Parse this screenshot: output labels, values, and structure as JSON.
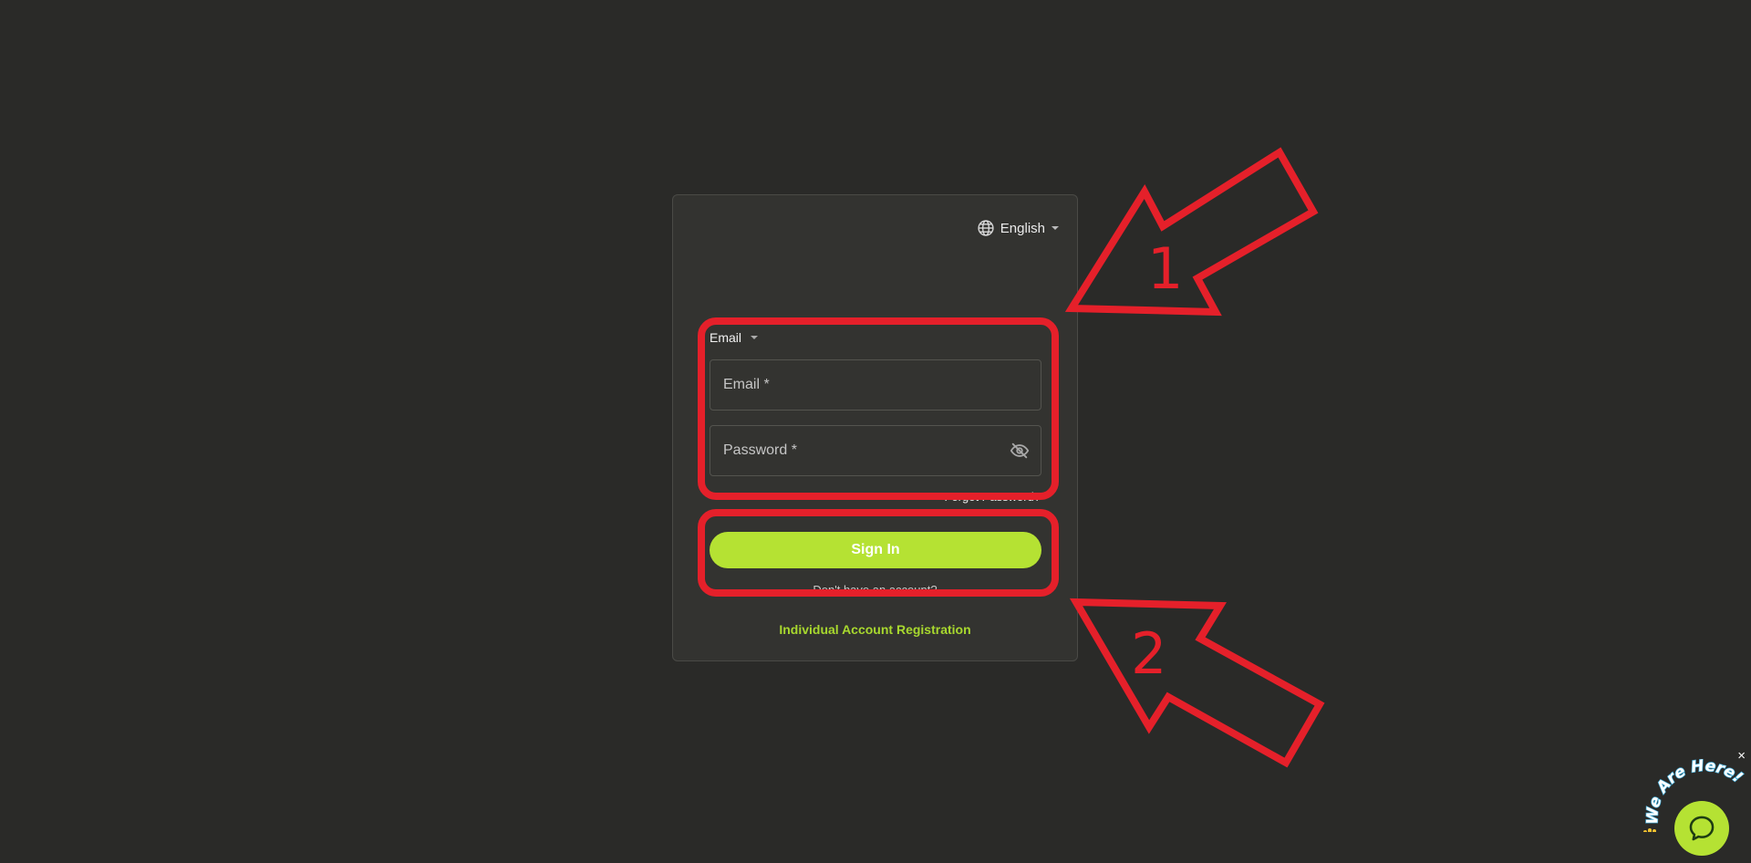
{
  "login": {
    "language": "English",
    "method_selector": "Email",
    "email_placeholder": "Email *",
    "password_placeholder": "Password *",
    "forgot_password": "Forgot Password?",
    "sign_in": "Sign In",
    "other_link": "Don't have an account?",
    "register_link": "Individual Account Registration"
  },
  "annotations": {
    "arrow1_label": "1",
    "arrow2_label": "2"
  },
  "chat_widget": {
    "tagline": "We Are Here!",
    "close_symbol": "×"
  },
  "colors": {
    "page_bg": "#2a2a28",
    "card_bg": "#333330",
    "accent": "#b5e233",
    "annotation_red": "#e5202a"
  },
  "icons": [
    "globe-icon",
    "chevron-down-icon",
    "eye-off-icon",
    "chat-bubble-icon",
    "close-icon",
    "wave-hand-icon"
  ]
}
